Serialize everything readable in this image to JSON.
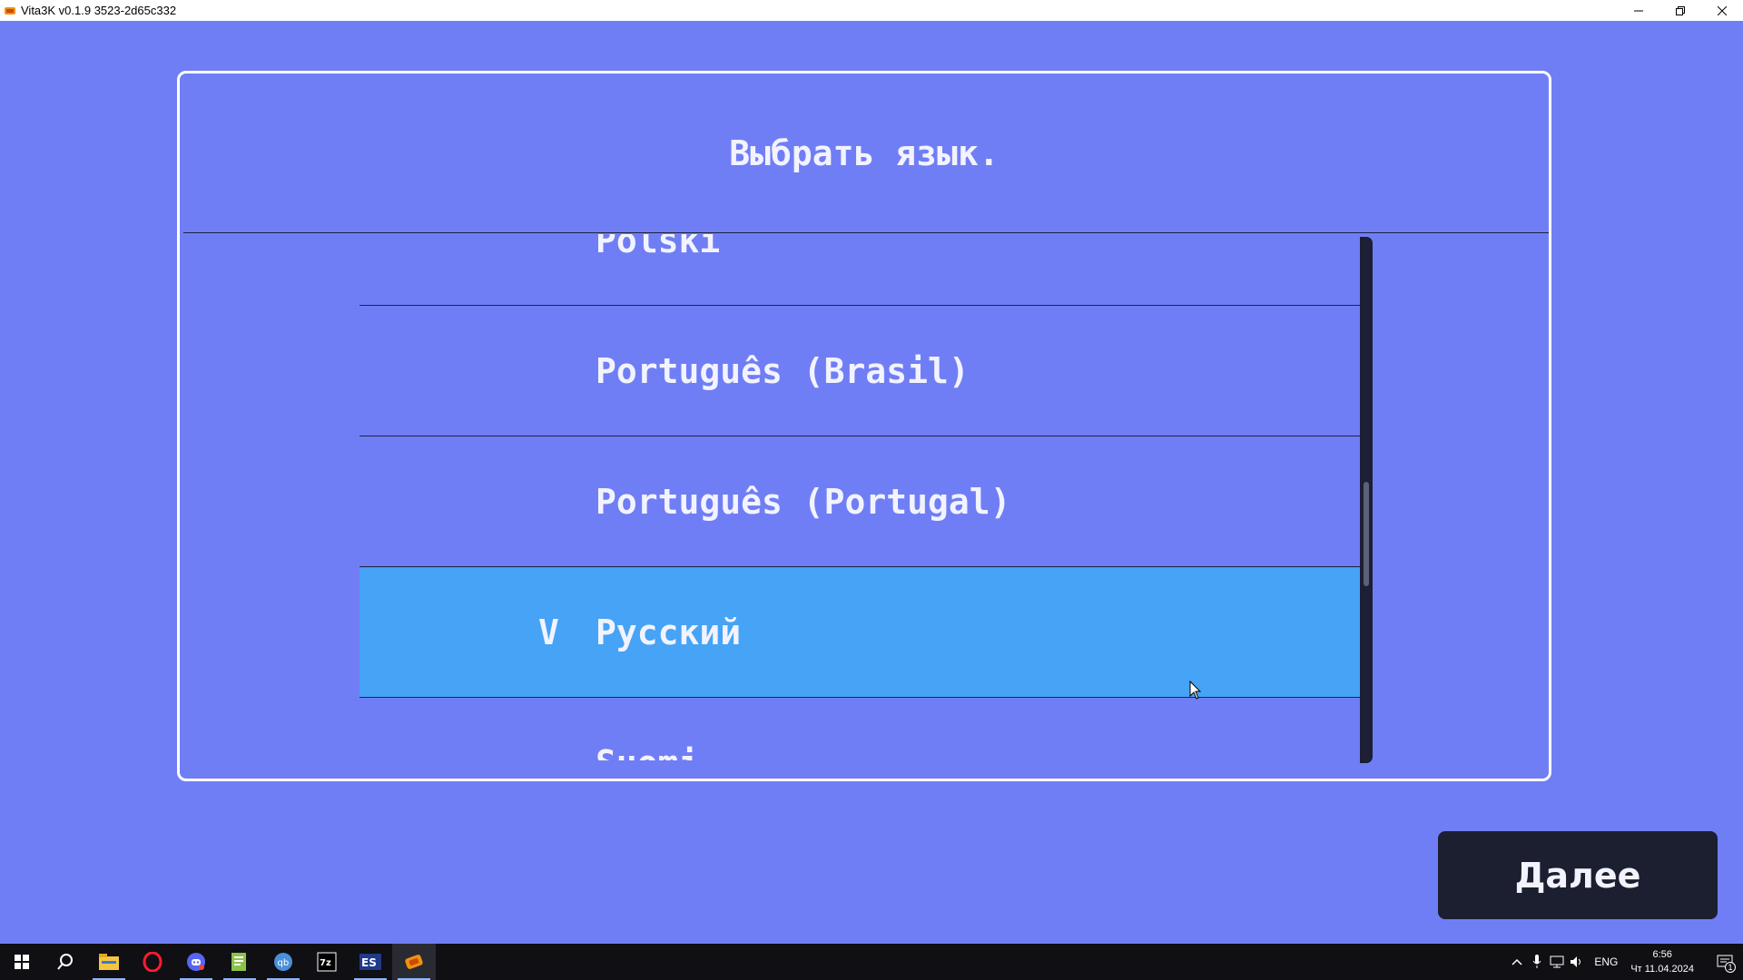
{
  "window": {
    "title": "Vita3K v0.1.9 3523-2d65c332",
    "icon": "vita3k-logo-icon",
    "controls": [
      "minimize-icon",
      "restore-icon",
      "close-icon"
    ]
  },
  "dialog": {
    "title": "Выбрать язык.",
    "languages": [
      {
        "label": "Polski",
        "selected": false
      },
      {
        "label": "Português (Brasil)",
        "selected": false
      },
      {
        "label": "Português (Portugal)",
        "selected": false
      },
      {
        "label": "Русский",
        "selected": true,
        "check": "V"
      },
      {
        "label": "Suomi",
        "selected": false
      }
    ],
    "scroll_position": 0.55
  },
  "next_button": {
    "label": "Далее"
  },
  "colors": {
    "background": "#707ef5",
    "selected_row": "#46a3f5",
    "button_bg": "#1c1f2f",
    "text": "#f2f3ff"
  },
  "taskbar": {
    "apps": [
      "windows-start-icon",
      "search-icon",
      "file-explorer-icon",
      "opera-icon",
      "discord-icon",
      "notepad-icon",
      "qbittorrent-icon",
      "7zip-icon",
      "es-icon",
      "vita3k-icon"
    ],
    "tray": {
      "icons": [
        "chevron-up-icon",
        "microphone-icon",
        "network-icon",
        "volume-icon"
      ],
      "language": "ENG",
      "time": "6:56",
      "date": "Чт 11.04.2024",
      "notifications": "1"
    }
  }
}
